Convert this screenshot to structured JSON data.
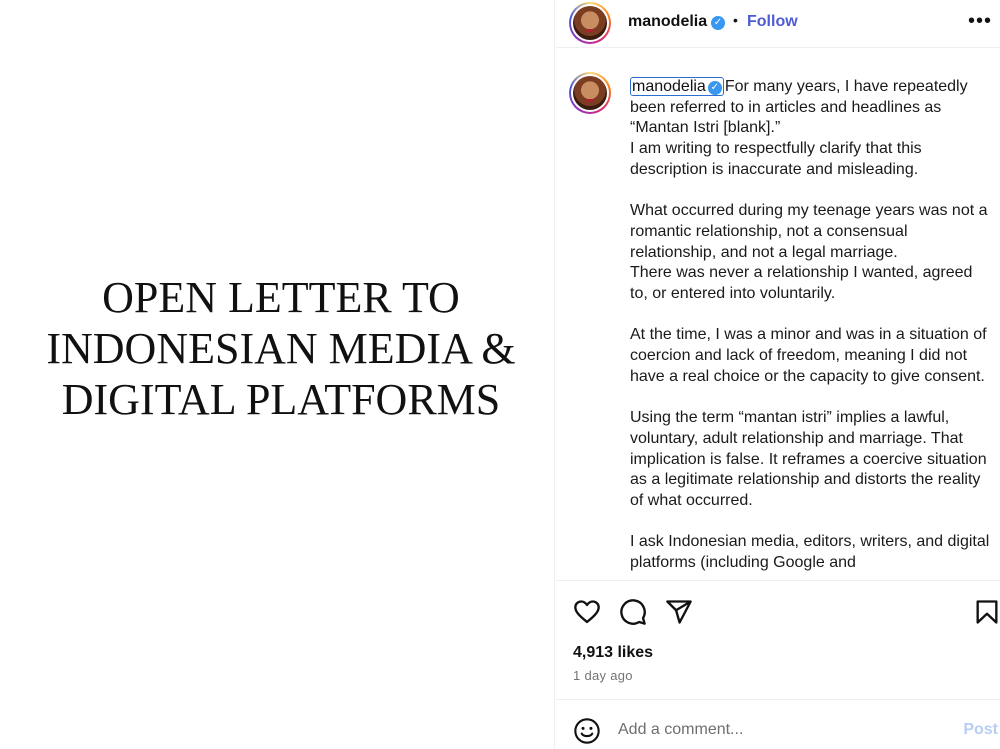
{
  "image_pane": {
    "title_lines": [
      "OPEN LETTER TO",
      "INDONESIAN MEDIA &",
      "DIGITAL PLATFORMS"
    ]
  },
  "header": {
    "username": "manodelia",
    "separator": "•",
    "follow_label": "Follow",
    "more_label": "•••"
  },
  "caption": {
    "username": "manodelia",
    "paragraphs": [
      [
        "For many years, I have repeatedly been referred to in articles and headlines as “Mantan Istri [blank].”",
        "I am writing to respectfully clarify that this description is inaccurate and misleading."
      ],
      [
        "What occurred during my teenage years was not a romantic relationship, not a consensual relationship, and not a legal marriage.",
        "There was never a relationship I wanted, agreed to, or entered into voluntarily."
      ],
      [
        "At the time, I was a minor and was in a situation of coercion and lack of freedom, meaning I did not have a real choice or the capacity to give consent."
      ],
      [
        "Using the term “mantan istri” implies a lawful, voluntary, adult relationship and marriage. That implication is false. It reframes a coercive situation as a legitimate relationship and distorts the reality of what occurred."
      ],
      [
        "I ask Indonesian media, editors, writers, and digital platforms (including Google and"
      ]
    ]
  },
  "stats": {
    "likes": "4,913 likes",
    "time": "1 day ago"
  },
  "comment": {
    "placeholder": "Add a comment...",
    "post_label": "Post"
  },
  "colors": {
    "follow": "#4f5bd5",
    "verified": "#3897f0",
    "post_disabled": "#b7cdf4",
    "focus_outline": "#2c6fd1"
  },
  "icons": {
    "verified": "verified-badge-icon",
    "like": "heart-icon",
    "comment": "comment-icon",
    "share": "paper-plane-icon",
    "save": "bookmark-icon",
    "emoji": "smiley-icon"
  }
}
